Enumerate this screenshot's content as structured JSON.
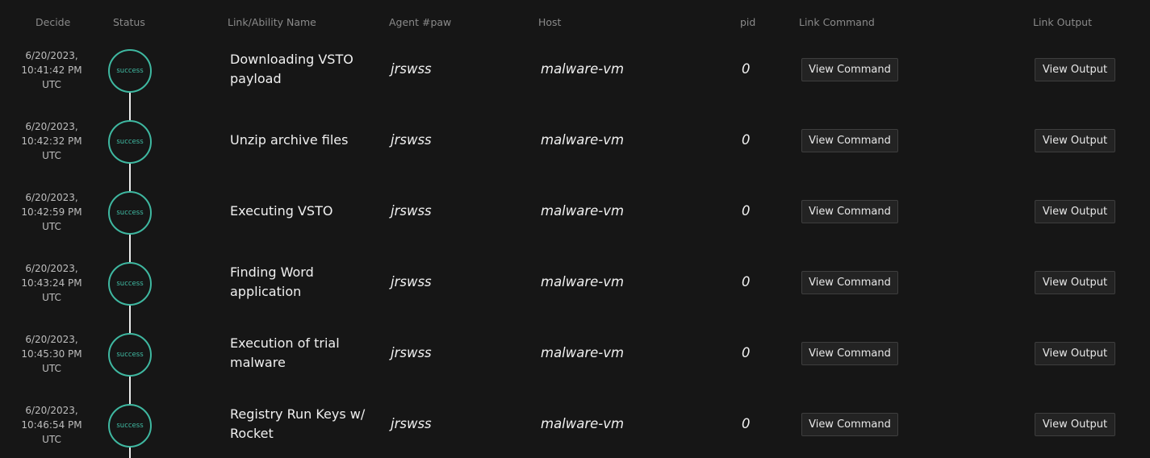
{
  "headers": {
    "decide": "Decide",
    "status": "Status",
    "ability": "Link/Ability Name",
    "agent": "Agent #paw",
    "host": "Host",
    "pid": "pid",
    "command": "Link Command",
    "output": "Link Output"
  },
  "colors": {
    "background": "#161616",
    "success": "#3fb8a1",
    "timeline": "#eaeaea"
  },
  "rows": [
    {
      "date": "6/20/2023,",
      "time": "10:41:42 PM",
      "tz": "UTC",
      "status": "success",
      "ability": "Downloading VSTO payload",
      "paw": "jrswss",
      "host": "malware-vm",
      "pid": "0",
      "command_label": "View Command",
      "output_label": "View Output"
    },
    {
      "date": "6/20/2023,",
      "time": "10:42:32 PM",
      "tz": "UTC",
      "status": "success",
      "ability": "Unzip archive files",
      "paw": "jrswss",
      "host": "malware-vm",
      "pid": "0",
      "command_label": "View Command",
      "output_label": "View Output"
    },
    {
      "date": "6/20/2023,",
      "time": "10:42:59 PM",
      "tz": "UTC",
      "status": "success",
      "ability": "Executing VSTO",
      "paw": "jrswss",
      "host": "malware-vm",
      "pid": "0",
      "command_label": "View Command",
      "output_label": "View Output"
    },
    {
      "date": "6/20/2023,",
      "time": "10:43:24 PM",
      "tz": "UTC",
      "status": "success",
      "ability": "Finding Word application",
      "paw": "jrswss",
      "host": "malware-vm",
      "pid": "0",
      "command_label": "View Command",
      "output_label": "View Output"
    },
    {
      "date": "6/20/2023,",
      "time": "10:45:30 PM",
      "tz": "UTC",
      "status": "success",
      "ability": "Execution of trial malware",
      "paw": "jrswss",
      "host": "malware-vm",
      "pid": "0",
      "command_label": "View Command",
      "output_label": "View Output"
    },
    {
      "date": "6/20/2023,",
      "time": "10:46:54 PM",
      "tz": "UTC",
      "status": "success",
      "ability": "Registry Run Keys w/ Rocket",
      "paw": "jrswss",
      "host": "malware-vm",
      "pid": "0",
      "command_label": "View Command",
      "output_label": "View Output"
    }
  ]
}
